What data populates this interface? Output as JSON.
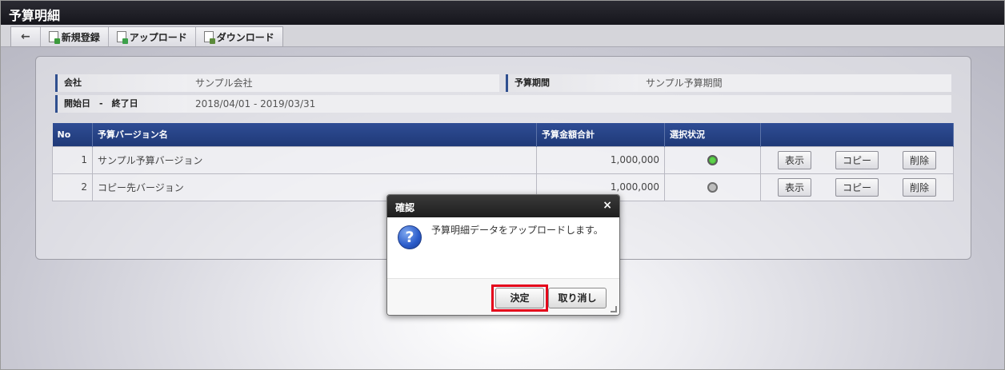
{
  "window": {
    "title": "予算明細"
  },
  "toolbar": {
    "back_label": "←",
    "new_label": "新規登録",
    "upload_label": "アップロード",
    "download_label": "ダウンロード"
  },
  "info": {
    "company_label": "会社",
    "company_value": "サンプル会社",
    "period_label": "予算期間",
    "period_value": "サンプル予算期間",
    "dates_label": "開始日　-　終了日",
    "dates_value": "2018/04/01 - 2019/03/31"
  },
  "table": {
    "headers": [
      "No",
      "予算バージョン名",
      "予算金額合計",
      "選択状況",
      ""
    ],
    "rows": [
      {
        "no": "1",
        "name": "サンプル予算バージョン",
        "amount": "1,000,000",
        "selected": true,
        "view": "表示",
        "copy": "コピー",
        "delete": "削除"
      },
      {
        "no": "2",
        "name": "コピー先バージョン",
        "amount": "1,000,000",
        "selected": false,
        "view": "表示",
        "copy": "コピー",
        "delete": "削除"
      }
    ]
  },
  "dialog": {
    "title": "確認",
    "close_icon": "×",
    "icon": "question-icon",
    "icon_glyph": "?",
    "message": "予算明細データをアップロードします。",
    "ok_label": "決定",
    "cancel_label": "取り消し"
  },
  "colors": {
    "header_blue": "#1f3978",
    "highlight_red": "#e4001a",
    "selected_green": "#3fb52f"
  }
}
